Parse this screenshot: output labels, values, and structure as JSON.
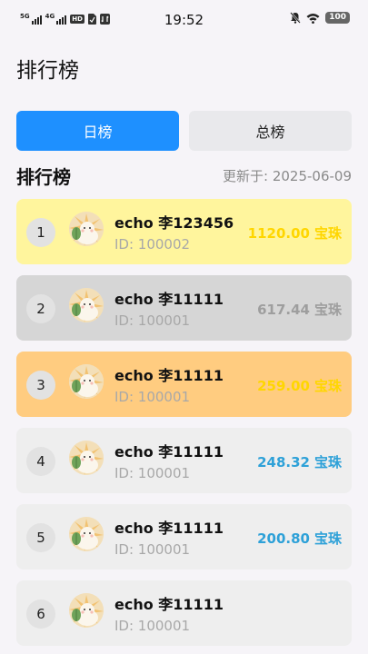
{
  "status_bar": {
    "time": "19:52",
    "signal_1": "5G",
    "signal_2": "4G",
    "hd": "HD",
    "battery": "100",
    "icons": [
      "signal-5g-icon",
      "signal-4g-icon",
      "hd-icon",
      "sim-icon",
      "data-icon",
      "mute-icon",
      "wifi-icon",
      "battery-icon"
    ]
  },
  "header": {
    "title": "排行榜"
  },
  "tabs": [
    {
      "label": "日榜",
      "active": true
    },
    {
      "label": "总榜",
      "active": false
    }
  ],
  "section": {
    "title": "排行榜",
    "updated": "更新于: 2025-06-09"
  },
  "colors": {
    "accent": "#1e90ff",
    "rank1_bg": "#fff59d",
    "rank2_bg": "#d6d6d6",
    "rank3_bg": "#ffcc80",
    "default_bg": "#eeeeee",
    "gold_text": "#ffd600",
    "silver_text": "#9e9e9e",
    "blue_text": "#2ea1d8"
  },
  "ranking": [
    {
      "rank": "1",
      "name": "echo 李123456",
      "id": "ID: 100002",
      "amount": "1120.00",
      "unit": "宝珠"
    },
    {
      "rank": "2",
      "name": "echo 李11111",
      "id": "ID: 100001",
      "amount": "617.44",
      "unit": "宝珠"
    },
    {
      "rank": "3",
      "name": "echo 李11111",
      "id": "ID: 100001",
      "amount": "259.00",
      "unit": "宝珠"
    },
    {
      "rank": "4",
      "name": "echo 李11111",
      "id": "ID: 100001",
      "amount": "248.32",
      "unit": "宝珠"
    },
    {
      "rank": "5",
      "name": "echo 李11111",
      "id": "ID: 100001",
      "amount": "200.80",
      "unit": "宝珠"
    },
    {
      "rank": "6",
      "name": "echo 李11111",
      "id": "ID: 100001",
      "amount": "",
      "unit": ""
    }
  ]
}
